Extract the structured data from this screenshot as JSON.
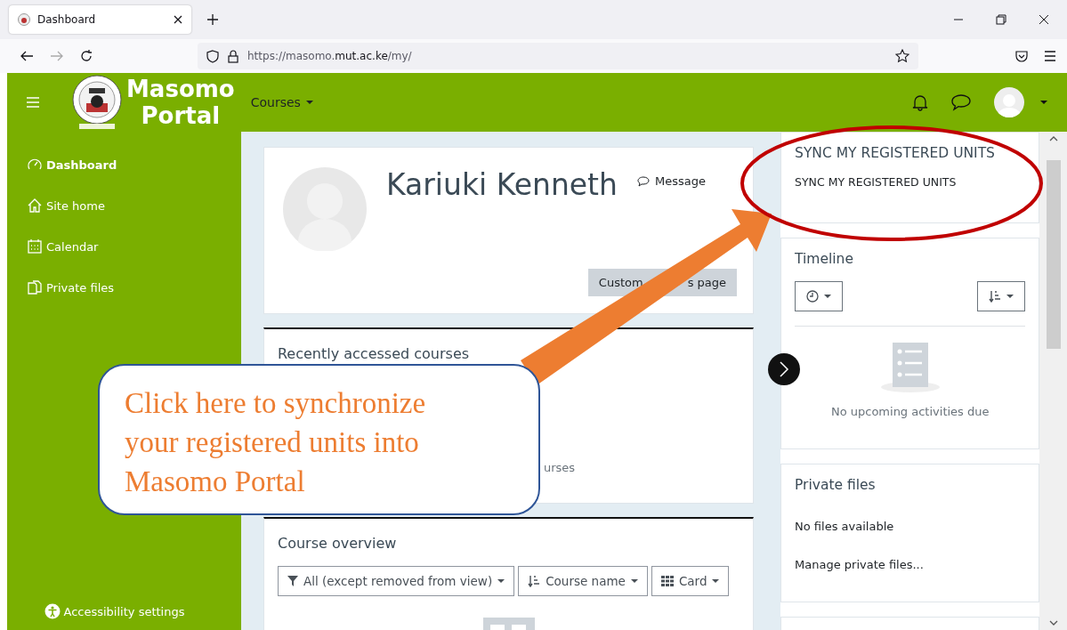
{
  "browser": {
    "tab_title": "Dashboard",
    "url_parts": [
      "https://masomo.",
      "mut.ac.ke",
      "/my/"
    ]
  },
  "header": {
    "site_name": [
      "Masomo",
      "Portal"
    ],
    "nav": "Courses"
  },
  "sidebar": {
    "items": [
      {
        "label": "Dashboard",
        "kind": "gauge",
        "selected": true
      },
      {
        "label": "Site home",
        "kind": "home",
        "selected": false
      },
      {
        "label": "Calendar",
        "kind": "calendar",
        "selected": false
      },
      {
        "label": "Private files",
        "kind": "files",
        "selected": false
      }
    ],
    "footer": "Accessibility settings"
  },
  "profile": {
    "name": "Kariuki Kenneth",
    "message": "Message",
    "customise_parts": [
      "Custom",
      "s page"
    ]
  },
  "recent": {
    "title": "Recently accessed courses",
    "empty_fragment": "urses"
  },
  "overview": {
    "title": "Course overview",
    "filters": [
      {
        "label": "All (except removed from view)",
        "kind": "filter"
      },
      {
        "label": "Course name",
        "kind": "sort"
      },
      {
        "label": "Card",
        "kind": "grid"
      }
    ]
  },
  "sync": {
    "title": "SYNC MY REGISTERED UNITS",
    "link": "SYNC MY REGISTERED UNITS"
  },
  "timeline": {
    "title": "Timeline",
    "empty": "No upcoming activities due"
  },
  "private_files": {
    "title": "Private files",
    "empty": "No files available",
    "manage": "Manage private files..."
  },
  "annotation": {
    "callout": "Click here to synchronize your registered units into Masomo Portal"
  }
}
